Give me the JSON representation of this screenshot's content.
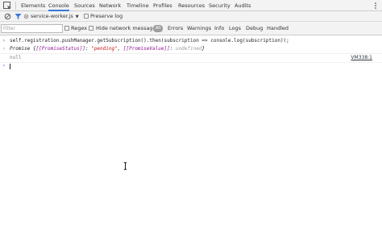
{
  "tabs": [
    {
      "label": "Elements"
    },
    {
      "label": "Console",
      "active": true
    },
    {
      "label": "Sources"
    },
    {
      "label": "Network"
    },
    {
      "label": "Timeline"
    },
    {
      "label": "Profiles"
    },
    {
      "label": "Resources"
    },
    {
      "label": "Security"
    },
    {
      "label": "Audits"
    }
  ],
  "toolbar": {
    "context": "service-worker.js",
    "preserve_log": "Preserve log"
  },
  "filterbar": {
    "filter_placeholder": "Filter",
    "regex": "Regex",
    "hide_network": "Hide network messages",
    "all": "All",
    "levels": [
      "Errors",
      "Warnings",
      "Info",
      "Logs",
      "Debug",
      "Handled"
    ]
  },
  "console": {
    "command": "self.registration.pushManager.getSubscription().then(subscription => console.log(subscription));",
    "result": {
      "prefix": "Promise {",
      "status_key": "[[PromiseStatus]]",
      "sep1": ": ",
      "status_val": "\"pending\"",
      "comma": ", ",
      "value_key": "[[PromiseValue]]",
      "sep2": ": ",
      "value_val": "undefined",
      "suffix": "}"
    },
    "log_text": "null",
    "log_source": "VM338:1"
  },
  "colors": {
    "accent": "#3879d9",
    "prompt": "#367cf1",
    "string": "#c41a16",
    "property": "#881391"
  }
}
